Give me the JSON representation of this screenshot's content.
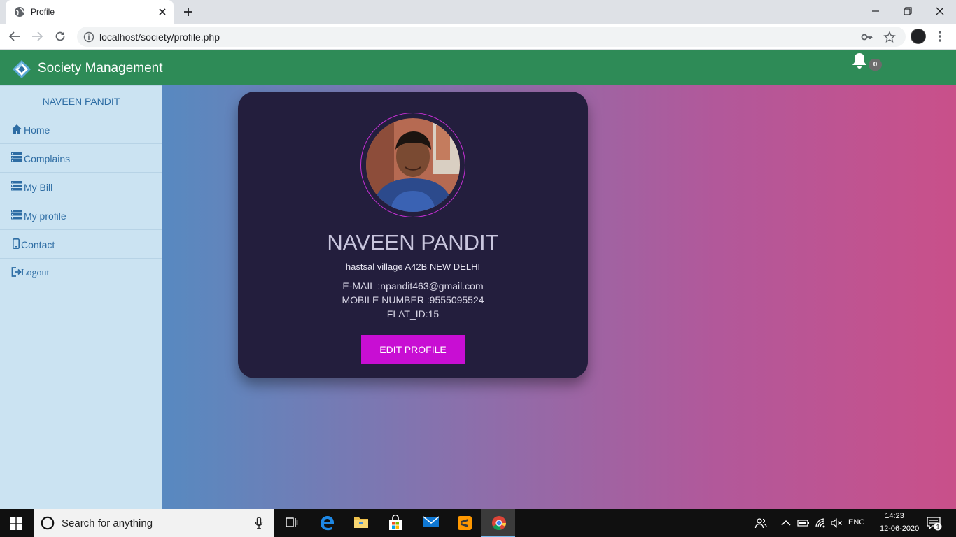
{
  "browser": {
    "tab_title": "Profile",
    "url": "localhost/society/profile.php"
  },
  "app": {
    "brand": "Society Management",
    "notification_count": "0"
  },
  "sidebar": {
    "user_name": "NAVEEN PANDIT",
    "items": [
      {
        "label": "Home",
        "icon": "home-icon"
      },
      {
        "label": "Complains",
        "icon": "list-icon"
      },
      {
        "label": "My Bill",
        "icon": "list-icon"
      },
      {
        "label": "My profile",
        "icon": "list-icon"
      },
      {
        "label": "Contact",
        "icon": "phone-icon"
      },
      {
        "label": "Logout",
        "icon": "logout-icon"
      }
    ]
  },
  "profile": {
    "name": "NAVEEN PANDIT",
    "address": "hastsal village A42B NEW DELHI",
    "email": "E-MAIL :npandit463@gmail.com",
    "mobile": "MOBILE NUMBER :9555095524",
    "flat": "FLAT_ID:15",
    "edit_label": "EDIT PROFILE"
  },
  "taskbar": {
    "search_placeholder": "Search for anything",
    "language": "ENG",
    "time": "14:23",
    "date": "12-06-2020",
    "notification_count": "1"
  },
  "colors": {
    "navbar": "#2e8b57",
    "sidebar": "#cbe3f2",
    "card": "#231e3d",
    "button": "#c80ed3",
    "gradient_start": "#3f93cb",
    "gradient_end": "#c9508a"
  }
}
